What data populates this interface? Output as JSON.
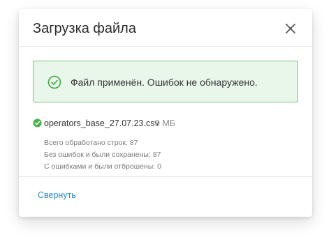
{
  "dialog": {
    "title": "Загрузка файла",
    "close_icon": "close-icon"
  },
  "alert": {
    "message": "Файл применён. Ошибок не обнаружено.",
    "icon": "check-circle-icon",
    "accent_color": "#4caf50",
    "background_color": "#e9f6ea"
  },
  "file": {
    "name": "operators_base_27.07.23.csv",
    "size": "9 МБ",
    "status_icon": "check-circle-filled-icon",
    "stats": [
      "Всего обработано строк: 87",
      "Без ошибок и были сохранены: 87",
      "С ошибками и были отброшены: 0"
    ]
  },
  "footer": {
    "collapse_label": "Свернуть",
    "link_color": "#2a8ad6"
  }
}
